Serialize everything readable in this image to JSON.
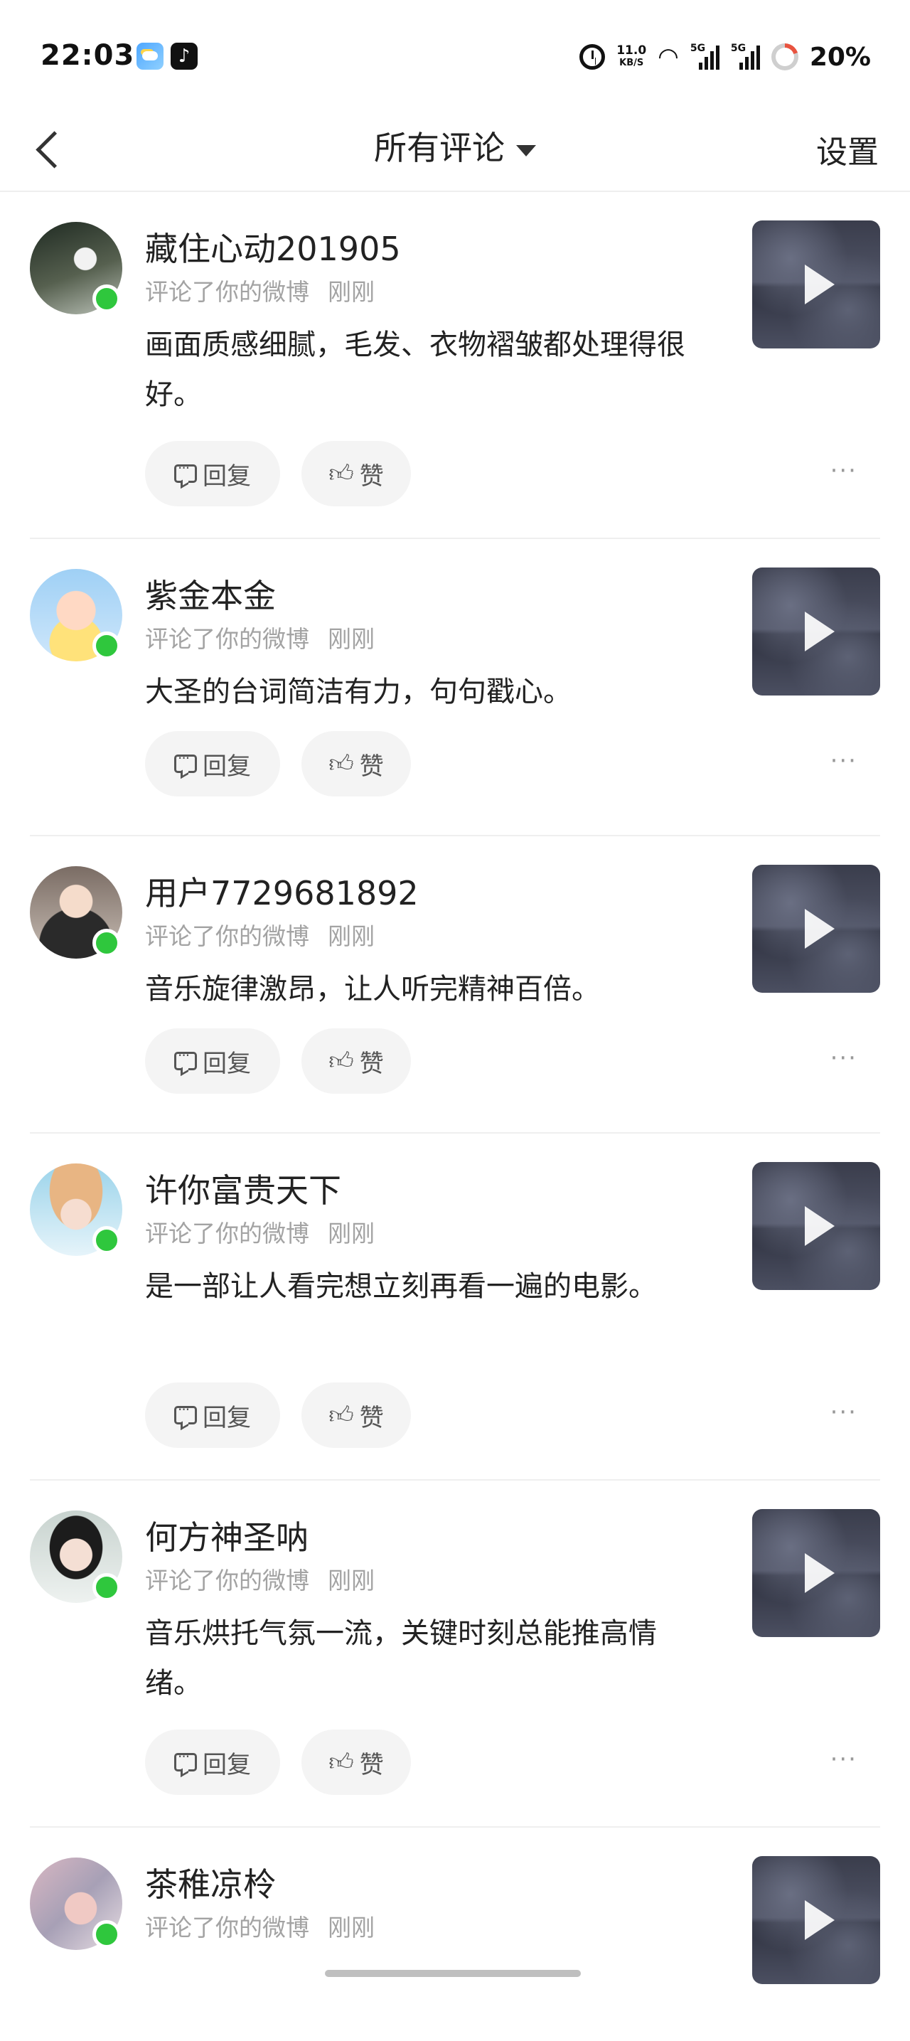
{
  "status_bar": {
    "time": "22:03",
    "net_speed_value": "11.0",
    "net_speed_unit": "KB/S",
    "signal_1_label": "5G",
    "signal_2_label": "5G",
    "battery": "20%"
  },
  "header": {
    "title": "所有评论",
    "settings_label": "设置"
  },
  "comments": [
    {
      "name": "藏住心动201905",
      "action": "评论了你的微博",
      "time": "刚刚",
      "text": "画面质感细腻，毛发、衣物褶皱都处理得很好。",
      "reply_label": "回复",
      "like_label": "赞"
    },
    {
      "name": "紫金本金",
      "action": "评论了你的微博",
      "time": "刚刚",
      "text": "大圣的台词简洁有力，句句戳心。",
      "reply_label": "回复",
      "like_label": "赞"
    },
    {
      "name": "用户7729681892",
      "action": "评论了你的微博",
      "time": "刚刚",
      "text": "音乐旋律激昂，让人听完精神百倍。",
      "reply_label": "回复",
      "like_label": "赞"
    },
    {
      "name": "许你富贵天下",
      "action": "评论了你的微博",
      "time": "刚刚",
      "text": "是一部让人看完想立刻再看一遍的电影。",
      "reply_label": "回复",
      "like_label": "赞"
    },
    {
      "name": "何方神圣呐",
      "action": "评论了你的微博",
      "time": "刚刚",
      "text": "音乐烘托气氛一流，关键时刻总能推高情绪。",
      "reply_label": "回复",
      "like_label": "赞"
    },
    {
      "name": "茶稚凉柃",
      "action": "评论了你的微博",
      "time": "刚刚"
    }
  ],
  "colors": {
    "online": "#2fc73d",
    "meta_text": "#a3a3a3",
    "pill_bg": "#f4f4f4"
  }
}
